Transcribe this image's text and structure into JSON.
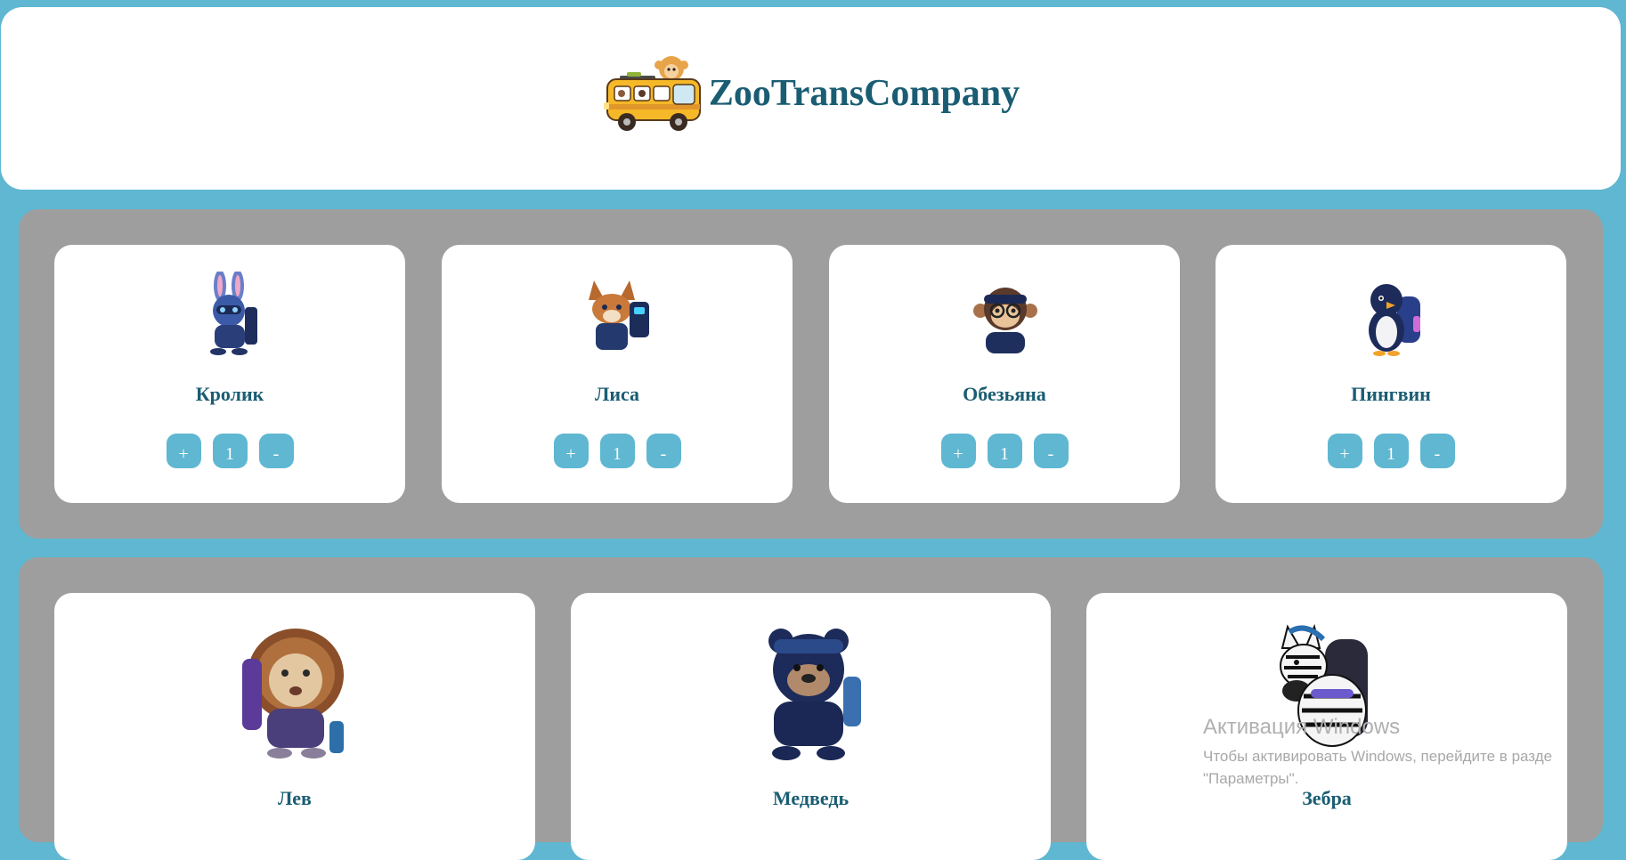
{
  "header": {
    "title": "ZooTransCompany",
    "logo_icon": "bus-with-monkey-icon"
  },
  "colors": {
    "background": "#5fb7d1",
    "panel": "#9e9e9e",
    "card": "#ffffff",
    "title": "#1a5d73",
    "button": "#5fb7d1"
  },
  "row1": [
    {
      "name": "Кролик",
      "icon": "robot-rabbit-icon",
      "plus": "+",
      "count": "1",
      "minus": "-"
    },
    {
      "name": "Лиса",
      "icon": "robot-fox-icon",
      "plus": "+",
      "count": "1",
      "minus": "-"
    },
    {
      "name": "Обезьяна",
      "icon": "robot-monkey-icon",
      "plus": "+",
      "count": "1",
      "minus": "-"
    },
    {
      "name": "Пингвин",
      "icon": "robot-penguin-icon",
      "plus": "+",
      "count": "1",
      "minus": "-"
    }
  ],
  "row2": [
    {
      "name": "Лев",
      "icon": "robot-lion-icon"
    },
    {
      "name": "Медведь",
      "icon": "robot-bear-icon"
    },
    {
      "name": "Зебра",
      "icon": "robot-zebra-icon"
    }
  ],
  "watermark": {
    "title": "Активация Windows",
    "line1": "Чтобы активировать Windows, перейдите в разде",
    "line2": "\"Параметры\"."
  }
}
